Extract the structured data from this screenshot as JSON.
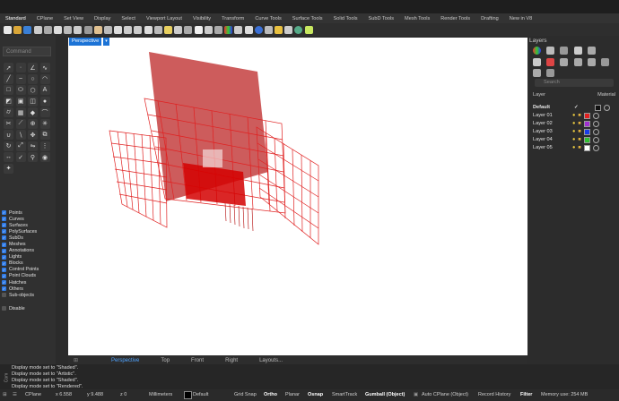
{
  "tabs": [
    "Standard",
    "CPlane",
    "Set View",
    "Display",
    "Select",
    "Viewport Layout",
    "Visibility",
    "Transform",
    "Curve Tools",
    "Surface Tools",
    "Solid Tools",
    "SubD Tools",
    "Mesh Tools",
    "Render Tools",
    "Drafting",
    "New in V8"
  ],
  "command": {
    "placeholder": "Command"
  },
  "filters": [
    {
      "label": "Points",
      "checked": true
    },
    {
      "label": "Curves",
      "checked": true
    },
    {
      "label": "Surfaces",
      "checked": true
    },
    {
      "label": "PolySurfaces",
      "checked": true
    },
    {
      "label": "SubDs",
      "checked": true
    },
    {
      "label": "Meshes",
      "checked": true
    },
    {
      "label": "Annotations",
      "checked": true
    },
    {
      "label": "Lights",
      "checked": true
    },
    {
      "label": "Blocks",
      "checked": true
    },
    {
      "label": "Control Points",
      "checked": true
    },
    {
      "label": "Point Clouds",
      "checked": true
    },
    {
      "label": "Hatches",
      "checked": true
    },
    {
      "label": "Others",
      "checked": true
    },
    {
      "label": "Sub-objects",
      "checked": false
    }
  ],
  "disable_label": "Disable",
  "viewport": {
    "label": "Perspective"
  },
  "viewport_tabs": [
    "Perspective",
    "Top",
    "Front",
    "Right",
    "Layouts..."
  ],
  "layers": {
    "title": "Layers",
    "search_placeholder": "Search",
    "col_layer": "Layer",
    "col_material": "Material",
    "rows": [
      {
        "name": "Default",
        "current": true,
        "color": "#111111"
      },
      {
        "name": "Layer 01",
        "current": false,
        "color": "#e02020"
      },
      {
        "name": "Layer 02",
        "current": false,
        "color": "#a030d0"
      },
      {
        "name": "Layer 03",
        "current": false,
        "color": "#1a3de8"
      },
      {
        "name": "Layer 04",
        "current": false,
        "color": "#30c030"
      },
      {
        "name": "Layer 05",
        "current": false,
        "color": "#ffffff"
      }
    ]
  },
  "history": [
    "Display mode set to \"Shaded\".",
    "Display mode set to \"Artistic\".",
    "Display mode set to \"Shaded\".",
    "Display mode set to \"Rendered\"."
  ],
  "command_label": "Com",
  "status": {
    "cplane": "CPlane",
    "x": "x 6.558",
    "y": "y 9.488",
    "z": "z 0",
    "units": "Millimeters",
    "layer": "Default",
    "grid_snap": "Grid Snap",
    "ortho": "Ortho",
    "planar": "Planar",
    "osnap": "Osnap",
    "smarttrack": "SmartTrack",
    "gumball": "Gumball (Object)",
    "auto_cplane": "Auto CPlane (Object)",
    "record_history": "Record History",
    "filter": "Filter",
    "memory": "Memory use: 254 MB"
  }
}
